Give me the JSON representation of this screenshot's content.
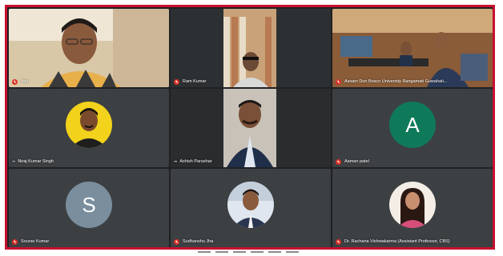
{
  "meeting": {
    "participants": [
      {
        "name": "You",
        "muted": true,
        "type": "video"
      },
      {
        "name": "Ram Kumar",
        "muted": true,
        "type": "video"
      },
      {
        "name": "Assam Don Bosco University Rangamati Guwahati...",
        "muted": true,
        "type": "video"
      },
      {
        "name": "Niraj Kumar Singh",
        "muted": false,
        "type": "photo"
      },
      {
        "name": "Ashish Parashar",
        "muted": false,
        "type": "video"
      },
      {
        "name": "Aaman patel",
        "muted": true,
        "type": "letter",
        "letter": "A",
        "color": "#0f7a5a"
      },
      {
        "name": "Sourav Kumar",
        "muted": true,
        "type": "letter",
        "letter": "S",
        "color": "#7a8e9e"
      },
      {
        "name": "Sudhanshu Jha",
        "muted": true,
        "type": "photo"
      },
      {
        "name": "Dr. Rachana Vishwakarma (Assistant Professor, CBS)",
        "muted": true,
        "type": "photo"
      }
    ]
  },
  "colors": {
    "frame_border": "#c8102e",
    "background": "#202124",
    "tile": "#3c4043",
    "mic_muted": "#d93025"
  },
  "icons": {
    "mic_off": "mic-off-icon",
    "more": "more-options-icon"
  }
}
